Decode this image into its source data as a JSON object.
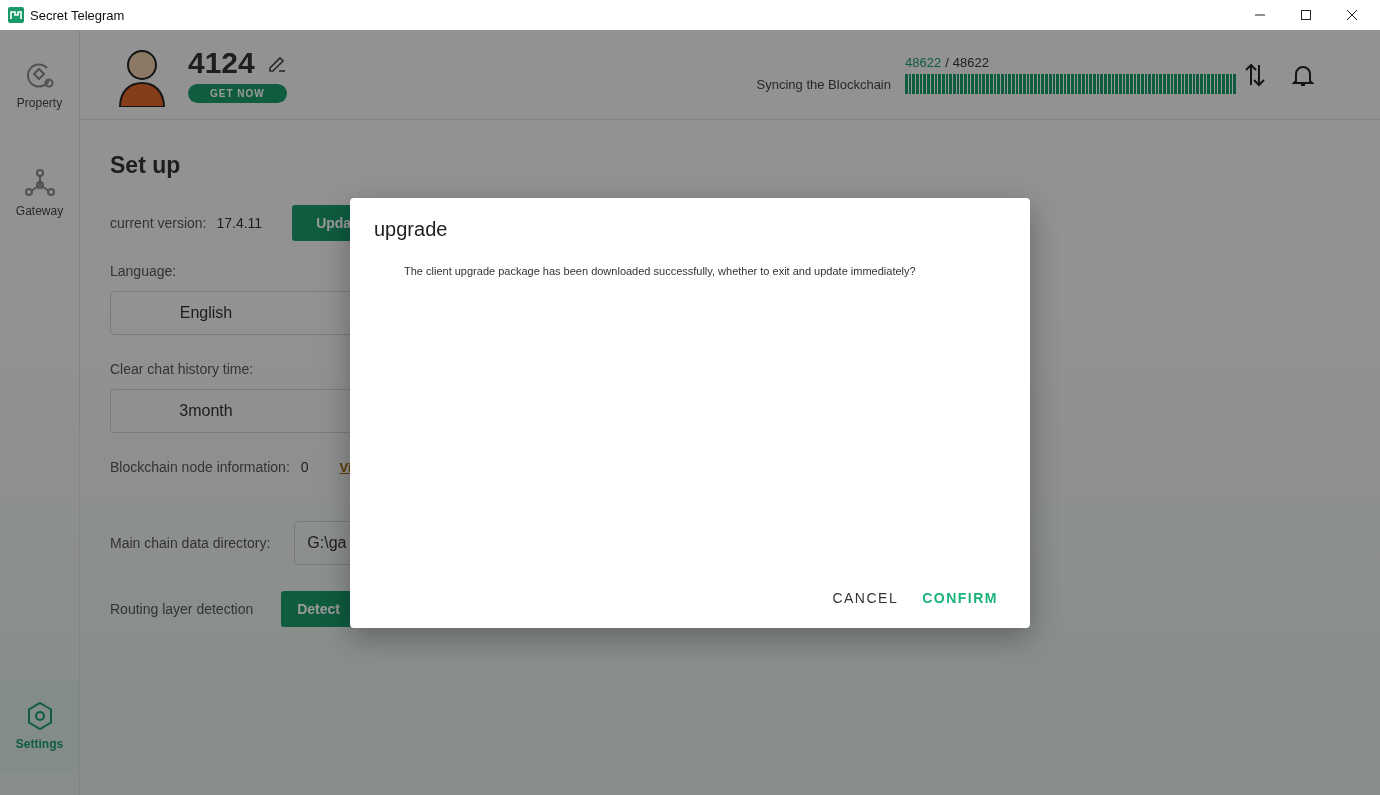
{
  "window": {
    "title": "Secret Telegram"
  },
  "sidebar": {
    "items": [
      {
        "label": "Property",
        "selected": false
      },
      {
        "label": "Gateway",
        "selected": false
      },
      {
        "label": "Settings",
        "selected": true
      }
    ]
  },
  "header": {
    "username": "4124",
    "badge": "GET NOW",
    "sync": {
      "current": "48622",
      "separator": "/",
      "total": "48622",
      "label": "Syncing the Blockchain",
      "level": 1
    }
  },
  "settings": {
    "title": "Set up",
    "rows": [
      {
        "kind": "version",
        "label": "current version:",
        "value": "17.4.11",
        "button": "Upda"
      },
      {
        "kind": "select",
        "label": "Language:",
        "value": "English"
      },
      {
        "kind": "select",
        "label": "Clear chat history time:",
        "value": "3month"
      },
      {
        "kind": "info",
        "label": "Blockchain node information:",
        "value": "0",
        "link": "Vi"
      },
      {
        "kind": "path",
        "label": "Main chain data directory:",
        "value": "G:\\ga"
      },
      {
        "kind": "action",
        "label": "Routing layer detection",
        "button": "Detect"
      }
    ]
  },
  "dialog": {
    "title": "upgrade",
    "message": "The client upgrade package has been downloaded successfully, whether to exit and update immediately?",
    "buttons": [
      {
        "label": "CANCEL",
        "primary": false
      },
      {
        "label": "CONFIRM",
        "primary": true
      }
    ]
  }
}
